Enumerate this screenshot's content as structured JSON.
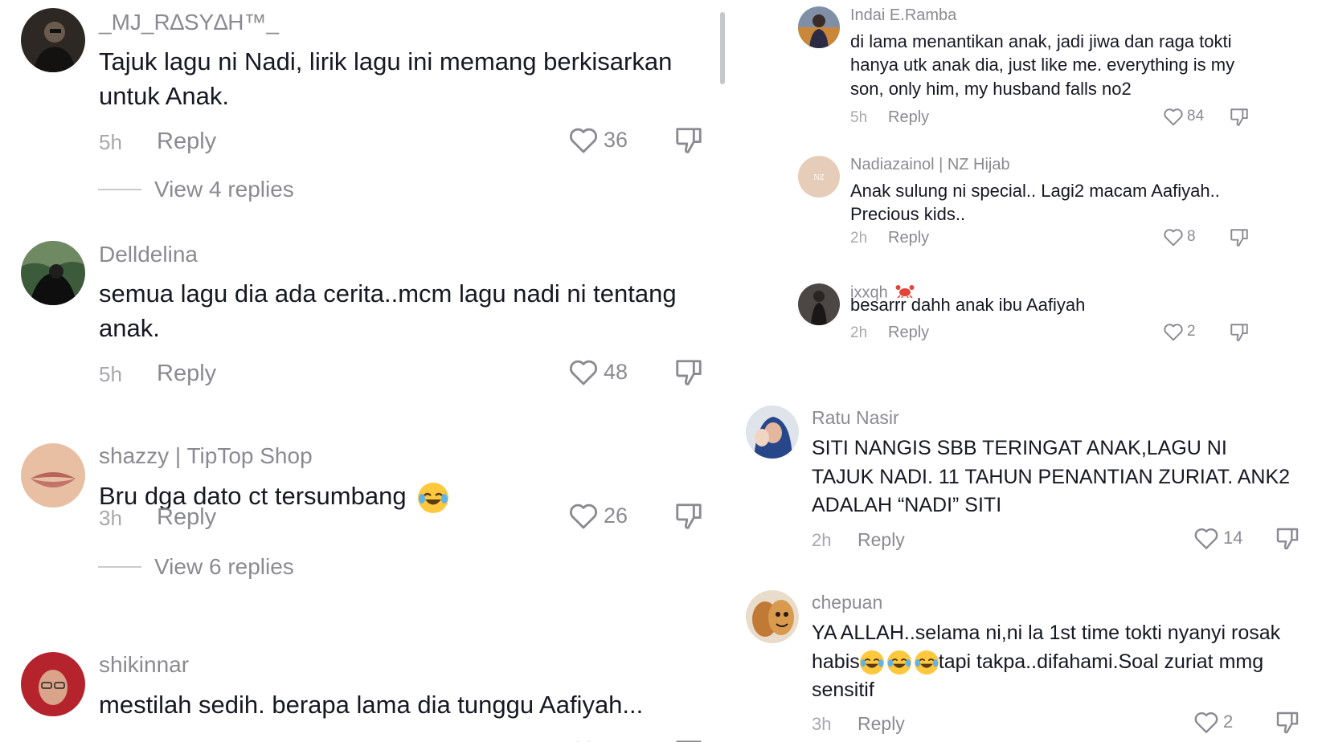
{
  "left": {
    "view_replies": [
      "View 4 replies",
      "View 6 replies"
    ],
    "comments": [
      {
        "username": "_MJ_R∆SY∆H™_",
        "text": "Tajuk lagu ni Nadi, lirik lagu ini memang berkisarkan untuk Anak.",
        "time": "5h",
        "reply": "Reply",
        "likes": "36"
      },
      {
        "username": "Delldelina",
        "text": "semua lagu dia ada cerita..mcm lagu nadi ni tentang anak.",
        "time": "5h",
        "reply": "Reply",
        "likes": "48"
      },
      {
        "username": "shazzy | TipTop Shop",
        "text": "Bru dga dato ct tersumbang",
        "time": "3h",
        "reply": "Reply",
        "likes": "26"
      },
      {
        "username": "shikinnar",
        "text": "mestilah sedih. berapa lama dia tunggu Aafiyah...",
        "time": "",
        "reply": "",
        "likes": ""
      }
    ]
  },
  "right": {
    "replies": [
      {
        "username": "Indai E.Ramba",
        "text": "di lama menantikan anak, jadi jiwa dan raga tokti hanya utk anak dia, just like me. everything is my son, only him, my husband falls no2",
        "time": "5h",
        "reply": "Reply",
        "likes": "84"
      },
      {
        "username": "Nadiazainol | NZ Hijab",
        "text": "Anak sulung ni special.. Lagi2 macam Aafiyah.. Precious kids..",
        "time": "2h",
        "reply": "Reply",
        "likes": "8"
      },
      {
        "username": "ixxqh",
        "text": "besarrr dahh anak ibu Aafiyah",
        "time": "2h",
        "reply": "Reply",
        "likes": "2"
      }
    ],
    "comments": [
      {
        "username": "Ratu Nasir",
        "text": "SITI NANGIS SBB TERINGAT ANAK,LAGU NI TAJUK NADI. 11 TAHUN PENANTIAN ZURIAT. ANK2 ADALAH “NADI” SITI",
        "time": "2h",
        "reply": "Reply",
        "likes": "14"
      },
      {
        "username": "chepuan",
        "text_before": "YA ALLAH..selama ni,ni la 1st time tokti nyanyi rosak habis",
        "text_after": "tapi takpa..difahami.Soal zuriat mmg sensitif",
        "time": "3h",
        "reply": "Reply",
        "likes": "2"
      }
    ]
  },
  "icons": {
    "like": "heart-outline-icon",
    "dislike": "thumbs-down-icon",
    "emoji": "face-with-tears-of-joy-emoji",
    "crab": "crab-emoji"
  },
  "colors": {
    "text": "#161823",
    "muted": "#8a8b91",
    "time": "#a7a8ad",
    "divider": "#c9cacd"
  }
}
